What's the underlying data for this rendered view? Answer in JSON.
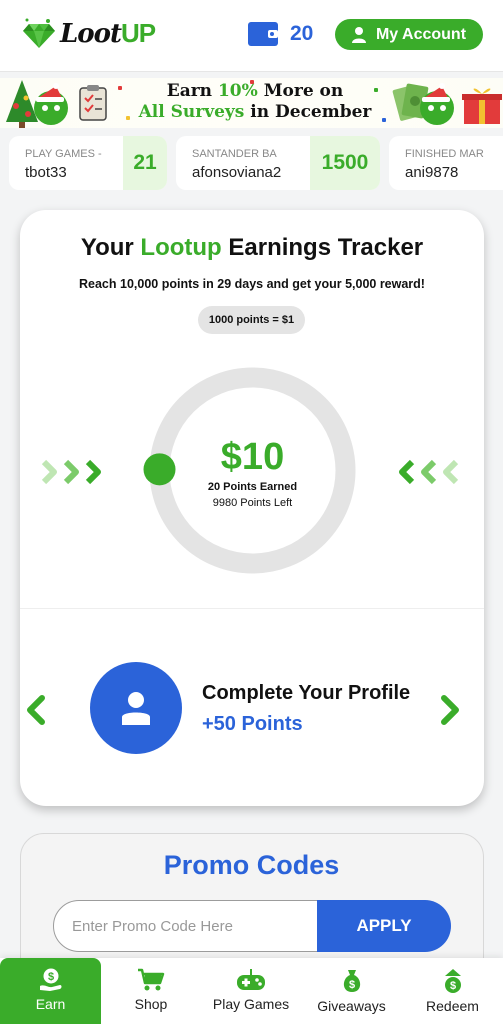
{
  "header": {
    "logo_text_left": "Loot",
    "logo_text_right": "UP",
    "wallet_count": "20",
    "account_label": "My Account"
  },
  "banner": {
    "line1_a": "Earn ",
    "line1_b": "10%",
    "line1_c": " More on",
    "line2_a": "All Surveys",
    "line2_b": " in December"
  },
  "activity": [
    {
      "subtitle": "PLAY GAMES -",
      "user": "tbot33",
      "points": "21"
    },
    {
      "subtitle": "SANTANDER BA",
      "user": "afonsoviana2",
      "points": "1500"
    },
    {
      "subtitle": "FINISHED MAR",
      "user": "ani9878",
      "points": ""
    }
  ],
  "tracker": {
    "title_a": "Your ",
    "title_b": "Lootup",
    "title_c": " Earnings Tracker",
    "subtitle": "Reach 10,000 points in 29 days and get your 5,000 reward!",
    "rate": "1000 points = $1",
    "amount": "$10",
    "earned": "20 Points Earned",
    "left": "9980 Points Left",
    "progress_fraction": 0.002
  },
  "profile": {
    "title": "Complete Your Profile",
    "points": "+50 Points"
  },
  "promo": {
    "title": "Promo Codes",
    "placeholder": "Enter Promo Code Here",
    "apply_label": "APPLY"
  },
  "nav": [
    {
      "label": "Earn",
      "icon": "earn-hand-coin-icon",
      "active": true
    },
    {
      "label": "Shop",
      "icon": "cart-icon",
      "active": false
    },
    {
      "label": "Play Games",
      "icon": "gamepad-icon",
      "active": false
    },
    {
      "label": "Giveaways",
      "icon": "money-bag-icon",
      "active": false
    },
    {
      "label": "Redeem",
      "icon": "redeem-coin-icon",
      "active": false
    }
  ],
  "colors": {
    "brand_green": "#3aac2a",
    "brand_blue": "#2b63d9"
  }
}
